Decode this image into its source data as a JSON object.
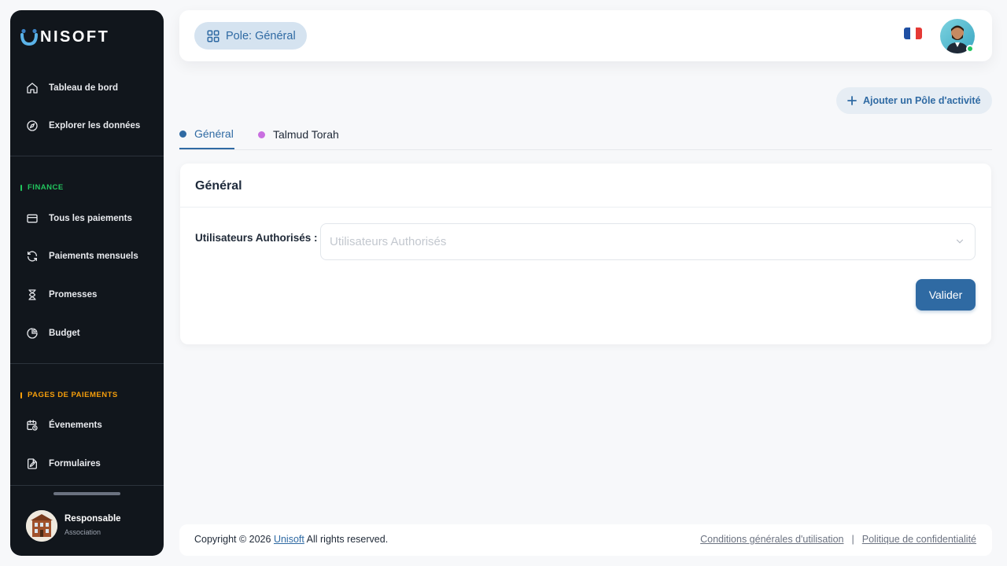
{
  "sidebar": {
    "brand": "NISOFT",
    "brand_mark": "unisoft-logo-icon",
    "items_main": [
      {
        "label": "Tableau de bord",
        "icon": "home-icon"
      },
      {
        "label": "Explorer les données",
        "icon": "compass-icon"
      }
    ],
    "finance": {
      "title": "FINANCE",
      "color": "#22c55e",
      "items": [
        {
          "label": "Tous les paiements",
          "icon": "credit-card-icon"
        },
        {
          "label": "Paiements mensuels",
          "icon": "refresh-icon"
        },
        {
          "label": "Promesses",
          "icon": "hourglass-icon"
        },
        {
          "label": "Budget",
          "icon": "pie-chart-icon"
        }
      ]
    },
    "pages": {
      "title": "PAGES DE PAIEMENTS",
      "color": "#f59e0b",
      "items": [
        {
          "label": "Évenements",
          "icon": "calendar-clock-icon"
        },
        {
          "label": "Formulaires",
          "icon": "file-edit-icon"
        }
      ]
    },
    "user": {
      "name": "Responsable",
      "role": "Association"
    }
  },
  "header": {
    "pole_label": "Pole: Général",
    "pole_icon": "grid-icon",
    "language": "FR",
    "flag_colors": [
      "#1f4fa3",
      "#ffffff",
      "#e53935"
    ]
  },
  "main": {
    "add_pole_label": "Ajouter un Pôle d'activité",
    "tabs": [
      {
        "label": "Général",
        "dot_color": "#2f6aa3",
        "active": true
      },
      {
        "label": "Talmud Torah",
        "dot_color": "#c96fe0",
        "active": false
      }
    ],
    "card": {
      "title": "Général",
      "field_label": "Utilisateurs Authorisés :",
      "field_placeholder": "Utilisateurs Authorisés",
      "submit_label": "Valider"
    }
  },
  "footer": {
    "copyright_prefix": "Copyright © 2026",
    "brand_link": "Unisoft",
    "copyright_suffix": "All rights reserved.",
    "terms": "Conditions générales d'utilisation",
    "separator": "|",
    "privacy": "Politique de confidentialité"
  },
  "colors": {
    "accent": "#2f6aa3",
    "sidebar_bg": "#11161c",
    "online": "#22c55e"
  }
}
